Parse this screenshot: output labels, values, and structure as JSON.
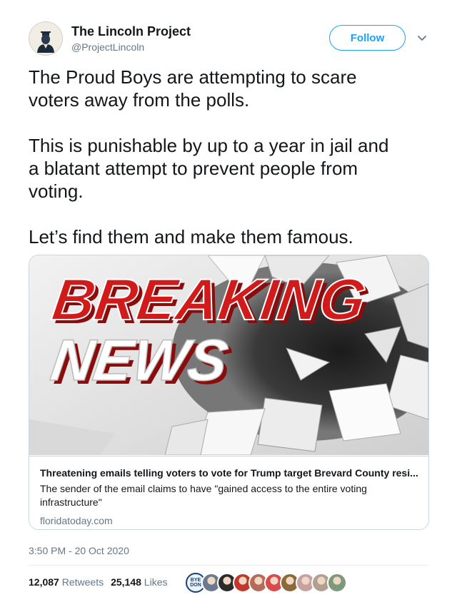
{
  "user": {
    "display_name": "The Lincoln Project",
    "handle": "@ProjectLincoln",
    "avatar_icon": "lincoln-portrait-icon"
  },
  "actions": {
    "follow_label": "Follow",
    "more_icon": "chevron-down-icon"
  },
  "tweet": {
    "paragraphs": [
      "The Proud Boys are attempting to scare\nvoters away from the polls.",
      "This is punishable by up to a year in jail and\na blatant attempt to prevent people from\nvoting.",
      "Let’s find them and make them famous."
    ]
  },
  "card": {
    "image_text_line1": "BREAKING",
    "image_text_line2": "NEWS",
    "title": "Threatening emails telling voters to vote for Trump target Brevard County resi...",
    "description": "The sender of the email claims to have \"gained access to the entire voting infrastructure\"",
    "domain": "floridatoday.com"
  },
  "timestamp": "3:50 PM - 20 Oct 2020",
  "stats": {
    "retweets_count": "12,087",
    "retweets_label": "Retweets",
    "likes_count": "25,148",
    "likes_label": "Likes"
  },
  "likers": {
    "badge_text": "BYE DON",
    "colors": [
      "#6b7a8f",
      "#2b2b2b",
      "#c0392b",
      "#b56a5a",
      "#d94a4a",
      "#8a6a3a",
      "#c7a0a0",
      "#b0a090",
      "#7a9a7a"
    ]
  },
  "colors": {
    "accent": "#1da1f2",
    "secondary_text": "#657786",
    "breaking_red": "#d11a1a"
  }
}
